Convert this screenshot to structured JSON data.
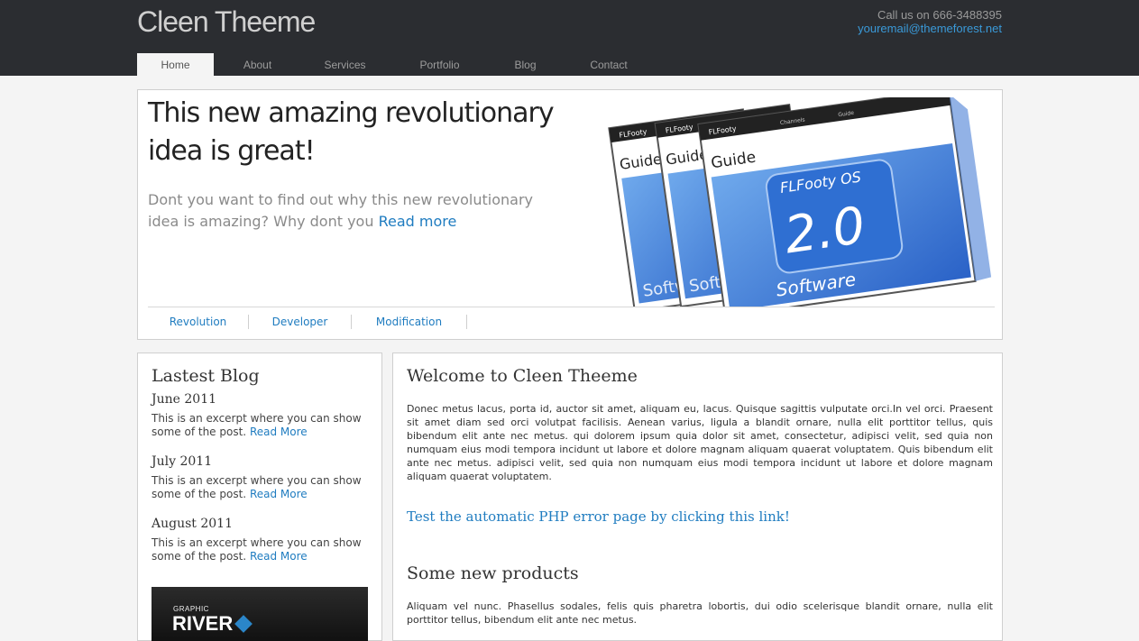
{
  "header": {
    "logo": "Cleen Theeme",
    "phone": "Call us on 666-3488395",
    "email": "youremail@themeforest.net"
  },
  "nav": {
    "items": [
      {
        "label": "Home",
        "active": true
      },
      {
        "label": "About"
      },
      {
        "label": "Services"
      },
      {
        "label": "Portfolio"
      },
      {
        "label": "Blog"
      },
      {
        "label": "Contact"
      }
    ]
  },
  "hero": {
    "title": "This new amazing revolutionary idea is great!",
    "subtitle": "Dont you want to find out why this new revolutionary idea is amazing? Why dont you",
    "read_more": "Read more",
    "image": {
      "nav_labels": [
        "FLFooty",
        "Channels",
        "Guide"
      ],
      "guide": "Guide",
      "product": "FLFooty OS",
      "version": "2.0",
      "kind": "Software"
    },
    "tabs": [
      "Revolution",
      "Developer",
      "Modification"
    ]
  },
  "sidebar": {
    "title": "Lastest Blog",
    "posts": [
      {
        "date": "June 2011",
        "excerpt": "This is an excerpt where you can show some of the post.",
        "link": "Read More"
      },
      {
        "date": "July 2011",
        "excerpt": "This is an excerpt where you can show some of the post.",
        "link": "Read More"
      },
      {
        "date": "August 2011",
        "excerpt": "This is an excerpt where you can show some of the post.",
        "link": "Read More"
      }
    ],
    "promo": {
      "small": "GRAPHIC",
      "big": "RIVER"
    }
  },
  "main": {
    "welcome_title": "Welcome to Cleen Theeme",
    "welcome_text": "Donec metus lacus, porta id, auctor sit amet, aliquam eu, lacus. Quisque sagittis vulputate orci.In vel orci. Praesent sit amet diam sed orci volutpat facilisis. Aenean varius, ligula a blandit ornare, nulla elit porttitor tellus, quis bibendum elit ante nec metus. qui dolorem ipsum quia dolor sit amet, consectetur, adipisci velit, sed quia non numquam eius modi tempora incidunt ut labore et dolore magnam aliquam quaerat voluptatem. Quis bibendum elit ante nec metus. adipisci velit, sed quia non numquam eius modi tempora incidunt ut labore et dolore magnam aliquam quaerat voluptatem.",
    "error_link": "Test the automatic PHP error page by clicking this link!",
    "products_title": "Some new products",
    "products_text": "Aliquam vel nunc. Phasellus sodales, felis quis pharetra lobortis, dui odio scelerisque blandit ornare, nulla elit porttitor tellus, bibendum elit ante nec metus."
  },
  "colors": {
    "header_bg": "#2b2d31",
    "link": "#1f7cc0",
    "page_bg": "#f4f4f4"
  }
}
